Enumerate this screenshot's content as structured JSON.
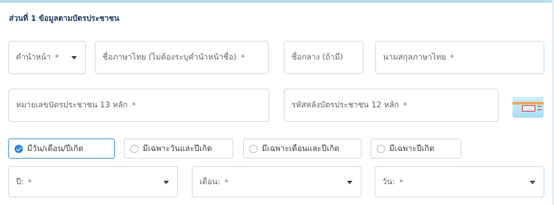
{
  "section": {
    "title": "ส่วนที่ 1 ข้อมูลตามบัตรประชาชน"
  },
  "fields": {
    "prefix": {
      "label": "คำนำหน้า",
      "required": "*"
    },
    "first_name_th": {
      "label": "ชื่อภาษาไทย (ไม่ต้องระบุคำนำหน้าชื่อ)",
      "required": "*"
    },
    "middle_name": {
      "label": "ชื่อกลาง (ถ้ามี)"
    },
    "last_name_th": {
      "label": "นามสกุลภาษาไทย",
      "required": "*"
    },
    "id_number": {
      "label": "หมายเลขบัตรประชาชน 13 หลัก",
      "required": "*"
    },
    "laser_code": {
      "label": "รหัสหลังบัตรประชาชน 12 หลัก",
      "required": "*"
    },
    "year": {
      "label": "ปี:",
      "required": "*"
    },
    "month": {
      "label": "เดือน:",
      "required": "*"
    },
    "day": {
      "label": "วัน:",
      "required": "*"
    }
  },
  "birthdate_options": [
    {
      "label": "มีวัน/เดือน/ปีเกิด",
      "selected": true
    },
    {
      "label": "มีเฉพาะวันและปีเกิด",
      "selected": false
    },
    {
      "label": "มีเฉพาะเดือนและปีเกิด",
      "selected": false
    },
    {
      "label": "มีเฉพาะปีเกิด",
      "selected": false
    }
  ],
  "icons": {
    "card_back": "id-card-back-icon",
    "caret": "chevron-down-icon",
    "check": "check-icon"
  },
  "colors": {
    "accent": "#2f86d6",
    "title": "#1f3a66",
    "border": "#d3d7dc",
    "topbar": "#b8dff0"
  }
}
